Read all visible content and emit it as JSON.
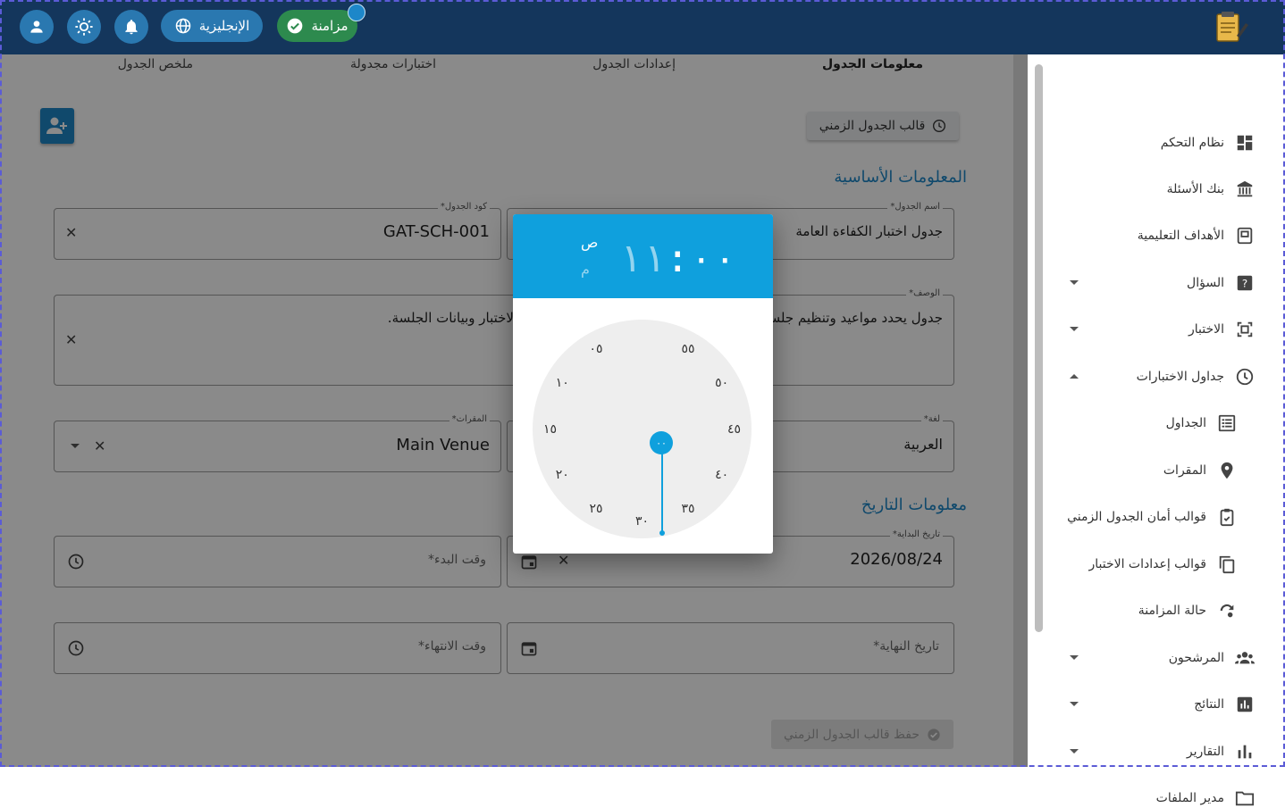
{
  "topbar": {
    "sync_label": "مزامنة",
    "language_label": "الإنجليزية",
    "icons": [
      "user-icon",
      "brightness-icon",
      "bell-icon",
      "globe-icon",
      "check-circle-icon",
      "app-logo-icon"
    ]
  },
  "sidebar": {
    "items": [
      {
        "label": "نظام التحكم",
        "icon": "dashboard-icon",
        "caret": ""
      },
      {
        "label": "بنك الأسئلة",
        "icon": "bank-icon",
        "caret": ""
      },
      {
        "label": "الأهداف التعليمية",
        "icon": "objectives-icon",
        "caret": ""
      },
      {
        "label": "السؤال",
        "icon": "question-icon",
        "caret": "down"
      },
      {
        "label": "الاختبار",
        "icon": "exam-icon",
        "caret": "down"
      },
      {
        "label": "جداول الاختبارات",
        "icon": "clock-icon",
        "caret": "up"
      },
      {
        "label": "الجداول",
        "icon": "list-icon",
        "caret": ""
      },
      {
        "label": "المقرات",
        "icon": "location-icon",
        "caret": ""
      },
      {
        "label": "قوالب أمان الجدول الزمني",
        "icon": "clipboard-check-icon",
        "caret": ""
      },
      {
        "label": "قوالب إعدادات الاختبار",
        "icon": "copy-icon",
        "caret": ""
      },
      {
        "label": "حالة المزامنة",
        "icon": "sync-status-icon",
        "caret": ""
      },
      {
        "label": "المرشحون",
        "icon": "people-icon",
        "caret": "down"
      },
      {
        "label": "النتائج",
        "icon": "results-icon",
        "caret": "down"
      },
      {
        "label": "التقارير",
        "icon": "reports-icon",
        "caret": "down"
      },
      {
        "label": "مدير الملفات",
        "icon": "folder-icon",
        "caret": ""
      }
    ]
  },
  "tabs": [
    {
      "label": "معلومات الجدول",
      "active": true
    },
    {
      "label": "إعدادات الجدول",
      "active": false
    },
    {
      "label": "اختبارات مجدولة",
      "active": false
    },
    {
      "label": "ملخص الجدول",
      "active": false
    }
  ],
  "toolbar": {
    "template_button": "قالب الجدول الزمني",
    "save_template_button": "حفظ قالب الجدول الزمني"
  },
  "sections": {
    "basic_info": "المعلومات الأساسية",
    "date_info": "معلومات التاريخ"
  },
  "form": {
    "schedule_name": {
      "label": "اسم الجدول*",
      "value": "جدول اختبار الكفاءة العامة"
    },
    "schedule_code": {
      "label": "كود الجدول*",
      "value": "GAT-SCH-001"
    },
    "description": {
      "label": "الوصف*",
      "value_right": "جدول يحدد مواعيد وتنظيم جلسا",
      "value_left": "لاختبار وبيانات الجلسة."
    },
    "language": {
      "label": "لغة*",
      "value": "العربية"
    },
    "venue": {
      "label": "المقرات*",
      "value": "Main Venue"
    },
    "start_date": {
      "label": "تاريخ البداية*",
      "value": "2026/08/24"
    },
    "start_time": {
      "placeholder": "وقت البدء*"
    },
    "end_date": {
      "placeholder": "تاريخ النهاية*"
    },
    "end_time": {
      "placeholder": "وقت الانتهاء*"
    }
  },
  "time_picker": {
    "hour": "١١",
    "minute": "٠٠",
    "am_label": "ص",
    "pm_label": "م",
    "selected_period": "am",
    "mode": "minutes",
    "selected_minute": "٠٠",
    "dial_numbers": [
      "٠٠",
      "٠٥",
      "١٠",
      "١٥",
      "٢٠",
      "٢٥",
      "٣٠",
      "٣٥",
      "٤٠",
      "٤٥",
      "٥٠",
      "٥٥"
    ]
  },
  "colors": {
    "topbar": "#14365c",
    "accent": "#0fa0dd",
    "sync_green": "#2d8a4e",
    "section_title": "#1e88c8"
  }
}
